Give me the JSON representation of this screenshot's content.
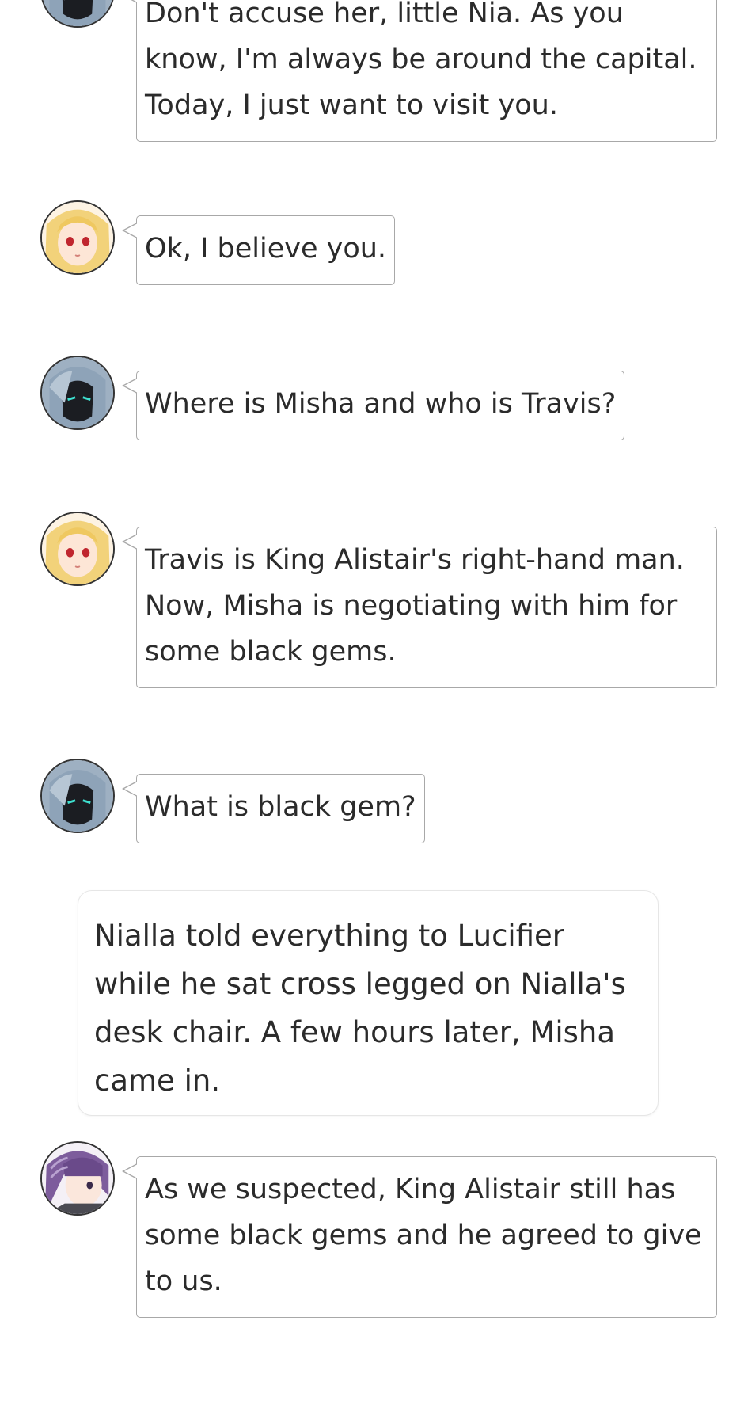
{
  "messages": [
    {
      "speaker": "lucifer",
      "text": "Don't accuse her, little Nia. As you know, I'm always be around the capital. Today, I just want to visit you."
    },
    {
      "speaker": "nialla",
      "text": "Ok, I believe you."
    },
    {
      "speaker": "lucifer",
      "text": "Where is Misha and who is Travis?"
    },
    {
      "speaker": "nialla",
      "text": "Travis is King Alistair's right-hand man. Now, Misha is negotiating with him for some black gems."
    },
    {
      "speaker": "lucifer",
      "text": "What is black gem?"
    },
    {
      "speaker": "misha",
      "text": "As we suspected, King Alistair still has some black gems and he agreed to give to us."
    }
  ],
  "narration": "Nialla told everything to Lucifier while he sat cross legged on Nialla's desk chair. A few hours later, Misha came in."
}
